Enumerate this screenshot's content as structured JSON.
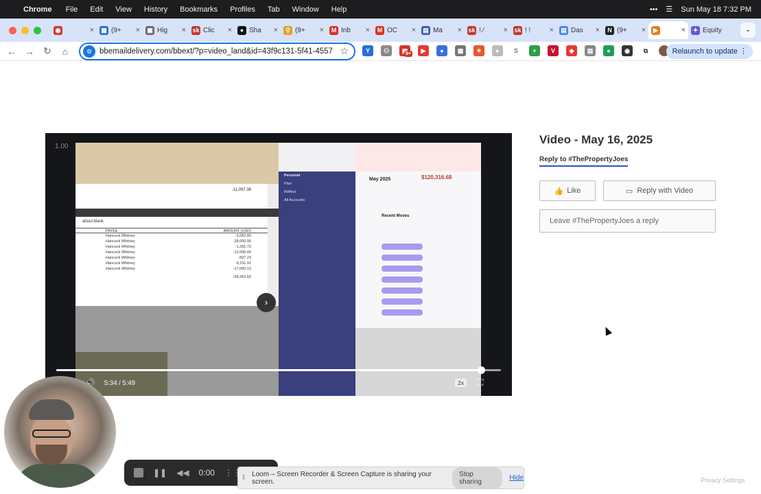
{
  "menubar": {
    "app": "Chrome",
    "items": [
      "File",
      "Edit",
      "View",
      "History",
      "Bookmarks",
      "Profiles",
      "Tab",
      "Window",
      "Help"
    ],
    "datetime": "Sun May 18  7:32 PM"
  },
  "tabs": [
    {
      "title": "",
      "fav": "#d23a3a",
      "fav_char": "◉"
    },
    {
      "title": "(9+",
      "fav": "#2c6ecb",
      "fav_char": "▦"
    },
    {
      "title": "Hig",
      "fav": "#6b6b6b",
      "fav_char": "▣"
    },
    {
      "title": "Clic",
      "fav": "#c0392b",
      "fav_char": "sk"
    },
    {
      "title": "Sha",
      "fav": "#111111",
      "fav_char": "●"
    },
    {
      "title": "(9+",
      "fav": "#e1a12a",
      "fav_char": "⚲"
    },
    {
      "title": "Inb",
      "fav": "#d93025",
      "fav_char": "M"
    },
    {
      "title": "OC",
      "fav": "#d93025",
      "fav_char": "M"
    },
    {
      "title": "Ma",
      "fav": "#3b5ba9",
      "fav_char": "▤"
    },
    {
      "title": "! ⁄",
      "fav": "#c0392b",
      "fav_char": "sk"
    },
    {
      "title": "! !",
      "fav": "#c0392b",
      "fav_char": "sk"
    },
    {
      "title": "Das",
      "fav": "#4285f4",
      "fav_char": "▤"
    },
    {
      "title": "(9+",
      "fav": "#222222",
      "fav_char": "N"
    },
    {
      "title": "",
      "fav": "#e67e22",
      "fav_char": "▶"
    },
    {
      "title": "Equity",
      "fav": "#6a5acd",
      "fav_char": "✦"
    }
  ],
  "toolbar": {
    "url": "bbemaildelivery.com/bbext/?p=video_land&id=43f9c131-5f41-4557-...",
    "relaunch_label": "Relaunch to update",
    "ext_badge": "9+"
  },
  "video": {
    "frame_time_label": "1.00",
    "current_time": "5:34",
    "duration": "5:49",
    "progress_fraction": 0.956,
    "speed_label": "2x",
    "inner": {
      "budget_month": "May 2025",
      "budget_amount": "$120,316.68",
      "sidebar_title": "Personal",
      "sidebar_items": [
        "Plan",
        "Reflect",
        "All Accounts"
      ],
      "recent_moves": "Recent Moves",
      "doc_title": "about:blank",
      "doc_total": "-11,097.36",
      "doc_headers": [
        "PAYEE",
        "AMOUNT (USD)"
      ],
      "doc_rows": [
        [
          "Hancock Whitney",
          "-3,082.80"
        ],
        [
          "Hancock Whitney",
          "-28,000.00"
        ],
        [
          "Hancock Whitney",
          "-1,281.73"
        ],
        [
          "Hancock Whitney",
          "-12,090.00"
        ],
        [
          "Hancock Whitney",
          "-837.23"
        ],
        [
          "Hancock Whitney",
          "-6,011.91"
        ],
        [
          "Hancock Whitney",
          "-17,060.13"
        ]
      ],
      "doc_sum": "-68,363.60"
    }
  },
  "page": {
    "title": "Video - May 16, 2025",
    "reply_tab": "Reply to #ThePropertyJoes",
    "like_label": "Like",
    "reply_video_label": "Reply with Video",
    "reply_placeholder": "Leave #ThePropertyJoes a reply",
    "privacy": "Privacy Settings"
  },
  "loom": {
    "timer": "0:00",
    "share_message": "Loom – Screen Recorder & Screen Capture is sharing your screen.",
    "stop_label": "Stop sharing",
    "hide_label": "Hide"
  },
  "colors": {
    "accent": "#1a73e8",
    "reply_underline": "#2a55b8"
  }
}
